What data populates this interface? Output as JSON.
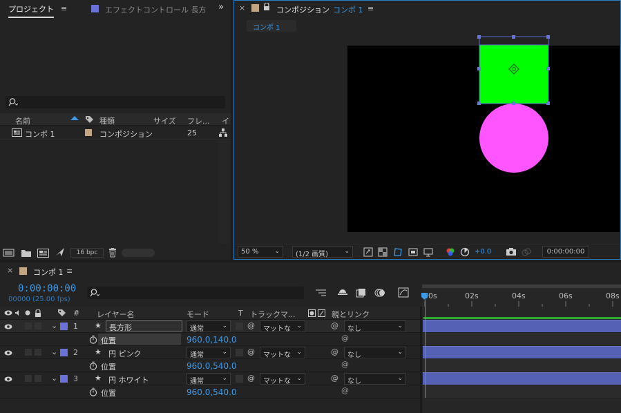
{
  "project": {
    "tab_label": "プロジェクト",
    "effect_tab_label": "エフェクトコントロール 長方",
    "columns": {
      "name": "名前",
      "type": "種類",
      "size": "サイズ",
      "frame": "フレ...",
      "extra": "イ"
    },
    "item": {
      "name": "コンポ 1",
      "type": "コンポジション",
      "frames": "25"
    },
    "bpc_label": "16 bpc"
  },
  "composition": {
    "panel_title": "コンポジション",
    "comp_name": "コンポ 1",
    "sub_tab": "コンポ 1",
    "zoom": "50 %",
    "quality": "(1/2 画質)",
    "exposure": "+0.0",
    "timecode": "0:00:00:00",
    "shapes": {
      "rectangle_color": "#00ff00",
      "circle_color": "#ff55ff",
      "canvas_color": "#000000"
    }
  },
  "timeline": {
    "tab_label": "コンポ 1",
    "timecode": "0:00:00:00",
    "frame_info": "00000 (25.00 fps)",
    "headers": {
      "layer_name": "レイヤー名",
      "mode": "モード",
      "t": "T",
      "track_matte": "トラックマ...",
      "parent": "親とリンク"
    },
    "ruler": [
      "00s",
      "02s",
      "04s",
      "06s",
      "08s"
    ],
    "layers": [
      {
        "num": "1",
        "name": "長方形",
        "mode": "通常",
        "matte": "マットな",
        "parent": "なし",
        "prop": "位置",
        "value": "960.0,140.0",
        "color": "#6a72d8"
      },
      {
        "num": "2",
        "name": "円 ピンク",
        "mode": "通常",
        "matte": "マットな",
        "parent": "なし",
        "prop": "位置",
        "value": "960.0,540.0",
        "color": "#6a72d8"
      },
      {
        "num": "3",
        "name": "円 ホワイト",
        "mode": "通常",
        "matte": "マットな",
        "parent": "なし",
        "prop": "位置",
        "value": "960.0,540.0",
        "color": "#6a72d8"
      }
    ]
  }
}
